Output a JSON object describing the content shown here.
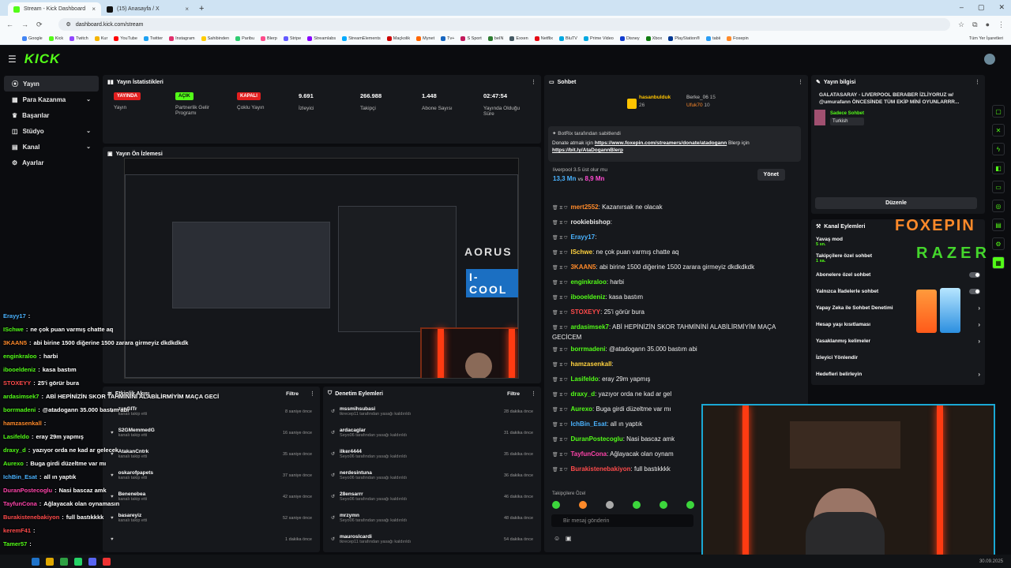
{
  "browser": {
    "tabs": [
      {
        "title": "Stream - Kick Dashboard"
      },
      {
        "title": "(15) Anasayfa / X"
      }
    ],
    "url": "dashboard.kick.com/stream",
    "bookmarks": [
      "Google",
      "Kick",
      "Twitch",
      "Kur",
      "YouTube",
      "Twitter",
      "Instagram",
      "Sahibinden",
      "Paribu",
      "Blerp",
      "Stripe",
      "Streamlabs",
      "StreamElements",
      "Maçkolik",
      "Mynet",
      "Tv+",
      "S Sport",
      "beIN",
      "Exxen",
      "Netflix",
      "BluTV",
      "Prime Video",
      "Disney",
      "Xbox",
      "PlayStation®",
      "tabii",
      "Foxepin"
    ],
    "all_bookmarks": "Tüm Yer İşaretleri"
  },
  "kick": {
    "logo": "KICK"
  },
  "sidebar": {
    "items": [
      {
        "label": "Yayın",
        "chev": ""
      },
      {
        "label": "Para Kazanma",
        "chev": "⌄"
      },
      {
        "label": "Başarılar",
        "chev": ""
      },
      {
        "label": "Stüdyo",
        "chev": "⌄"
      },
      {
        "label": "Kanal",
        "chev": "⌄"
      },
      {
        "label": "Ayarlar",
        "chev": ""
      }
    ]
  },
  "stats": {
    "title": "Yayın İstatistikleri",
    "cells": [
      {
        "pill": "YAYINDA",
        "label": "Yayın"
      },
      {
        "pill": "AÇIK",
        "label": "Partnerlik Gelir Programı"
      },
      {
        "pill": "KAPALI",
        "label": "Çoklu Yayın"
      },
      {
        "value": "9.691",
        "label": "İzleyici"
      },
      {
        "value": "266.988",
        "label": "Takipçi"
      },
      {
        "value": "1.448",
        "label": "Abone Sayısı"
      },
      {
        "value": "02:47:54",
        "label": "Yayında Olduğu Süre"
      }
    ]
  },
  "preview": {
    "title": "Yayın Ön İzlemesi"
  },
  "overlay_chat": [
    {
      "user": "Erayy17",
      "msg": ""
    },
    {
      "user": "ISchwe",
      "msg": "ne çok puan varmış chatte aq"
    },
    {
      "user": "3KAAN5",
      "msg": "abi birine 1500 diğerine 1500 zarara girmeyiz dkdkdkdk"
    },
    {
      "user": "enginkraloo",
      "msg": "harbi"
    },
    {
      "user": "ibooeldeniz",
      "msg": "kasa bastım"
    },
    {
      "user": "STOXEYY",
      "msg": "25'i görür bura"
    },
    {
      "user": "ardasimsek7",
      "msg": "ABİ HEPİNİZİN SKOR TAHMİNİNİ ALABİLİRMİYİM MAÇA GECİ"
    },
    {
      "user": "borrmadeni",
      "msg": "@atadogann 35.000 bastım abi"
    },
    {
      "user": "hamzasenkall",
      "msg": ""
    },
    {
      "user": "Lasifeldo",
      "msg": "eray 29m yapmış"
    },
    {
      "user": "draxy_d",
      "msg": "yazıyor orda ne kad ar gelecek"
    },
    {
      "user": "Aurexo",
      "msg": "Buga girdi düzeltme var mı"
    },
    {
      "user": "IchBin_Esat",
      "msg": "all ın yaptık"
    },
    {
      "user": "DuranPostecoglu",
      "msg": "Nasi bascaz amk"
    },
    {
      "user": "TayfunCona",
      "msg": "Ağlayacak olan oynamasın"
    },
    {
      "user": "Burakistenebakiyon",
      "msg": "full bastıkkkk"
    },
    {
      "user": "keremF41",
      "msg": ""
    },
    {
      "user": "Tamer57",
      "msg": ""
    }
  ],
  "activity": {
    "title": "Etkinlik Akışı",
    "filter": "Filtre",
    "items": [
      {
        "name": "zanGITr",
        "sub": "kanalı takip etti",
        "time": "8 saniye önce"
      },
      {
        "name": "S2GMemmedG",
        "sub": "kanalı takip etti",
        "time": "16 saniye önce"
      },
      {
        "name": "AtakanCntrk",
        "sub": "kanalı takip etti",
        "time": "35 saniye önce"
      },
      {
        "name": "oskarofpapets",
        "sub": "kanalı takip etti",
        "time": "37 saniye önce"
      },
      {
        "name": "Benenebea",
        "sub": "kanalı takip etti",
        "time": "42 saniye önce"
      },
      {
        "name": "basareyiz",
        "sub": "kanalı takip etti",
        "time": "52 saniye önce"
      },
      {
        "name": "",
        "sub": "",
        "time": "1 dakika önce"
      }
    ]
  },
  "moderation": {
    "title": "Denetim Eylemleri",
    "filter": "Filtre",
    "items": [
      {
        "name": "mssmihsubasi",
        "sub": "tkrecep11 tarafından yasağı kaldırıldı",
        "time": "28 dakika önce"
      },
      {
        "name": "ardacaglar",
        "sub": "Seyo06 tarafından yasağı kaldırıldı",
        "time": "31 dakika önce"
      },
      {
        "name": "ilker4444",
        "sub": "Seyo06 tarafından yasağı kaldırıldı",
        "time": "35 dakika önce"
      },
      {
        "name": "nerdesintuna",
        "sub": "Seyo06 tarafından yasağı kaldırıldı",
        "time": "36 dakika önce"
      },
      {
        "name": "28ensarrr",
        "sub": "Seyo06 tarafından yasağı kaldırıldı",
        "time": "46 dakika önce"
      },
      {
        "name": "mrzymn",
        "sub": "Seyo06 tarafından yasağı kaldırıldı",
        "time": "48 dakika önce"
      },
      {
        "name": "mauroslcardi",
        "sub": "tkrecep11 tarafından yasağı kaldırıldı",
        "time": "54 dakika önce"
      }
    ]
  },
  "chat": {
    "title": "Sohbet",
    "top_gifters": [
      {
        "name": "hasanbulduk",
        "count": "26"
      },
      {
        "name": "Berke_06",
        "count": "15"
      },
      {
        "name": "Ufuk70",
        "count": "10"
      }
    ],
    "pinned": {
      "by": "BotRix tarafından sabitlendi",
      "text": "Donate atmak için",
      "link1": "https://www.foxepin.com/streamers/donate/atadogann",
      "mid": "Blerp için",
      "link2": "https://bit.ly/AtaDogannBlerp"
    },
    "poll": {
      "question": "liverpool 3.5 üst olur mu",
      "a": "13,3 Mn",
      "vs": "vs",
      "b": "8,9 Mn",
      "manage": "Yönet"
    },
    "messages": [
      {
        "user": "mert2552",
        "color": "#ff8a2a",
        "msg": "Kazanırsak ne olacak"
      },
      {
        "user": "rookiebishop",
        "color": "#e8e8e8",
        "msg": ""
      },
      {
        "user": "Erayy17",
        "color": "#4ab3ff",
        "msg": ""
      },
      {
        "user": "ISchwe",
        "color": "#ffd23f",
        "msg": "ne çok puan varmış chatte aq"
      },
      {
        "user": "3KAAN5",
        "color": "#ff8a2a",
        "msg": "abi birine 1500 diğerine 1500 zarara girmeyiz dkdkdkdk"
      },
      {
        "user": "enginkraloo",
        "color": "#53fc18",
        "msg": "harbi"
      },
      {
        "user": "ibooeldeniz",
        "color": "#53fc18",
        "msg": "kasa bastım"
      },
      {
        "user": "STOXEYY",
        "color": "#ff4b4b",
        "msg": "25'i görür bura"
      },
      {
        "user": "ardasimsek7",
        "color": "#53fc18",
        "msg": "ABİ HEPİNİZİN SKOR TAHMİNİNİ ALABİLİRMİYİM MAÇA GECİCEM"
      },
      {
        "user": "borrmadeni",
        "color": "#53fc18",
        "msg": "@atadogann 35.000 bastım abi"
      },
      {
        "user": "hamzasenkall",
        "color": "#ffd23f",
        "msg": ""
      },
      {
        "user": "Lasifeldo",
        "color": "#53fc18",
        "msg": "eray 29m yapmış"
      },
      {
        "user": "draxy_d",
        "color": "#53fc18",
        "msg": "yazıyor orda ne kad ar gel"
      },
      {
        "user": "Aurexo",
        "color": "#53fc18",
        "msg": "Buga girdi düzeltme var mı"
      },
      {
        "user": "IchBin_Esat",
        "color": "#4ab3ff",
        "msg": "all ın yaptık"
      },
      {
        "user": "DuranPostecoglu",
        "color": "#53fc18",
        "msg": "Nasi bascaz amk"
      },
      {
        "user": "TayfunCona",
        "color": "#f4a",
        "msg": "Ağlayacak olan oynam"
      },
      {
        "user": "Burakistenebakiyon",
        "color": "#ff4b4b",
        "msg": "full bastıkkkk"
      }
    ],
    "followers_only_label": "Takipçilere Özel",
    "input_placeholder": "Bir mesaj gönderin"
  },
  "stream_info": {
    "title": "Yayın bilgisi",
    "stream_title": "GALATASARAY - LIVERPOOL BERABER İZLİYORUZ w/ @umurafann ÖNCESİNDE TÜM EKİP MİNİ OYUNLARRR...",
    "tag1": "Sadece Sohbet",
    "tag2": "Turkish",
    "edit": "Düzenle"
  },
  "channel_actions": {
    "title": "Kanal Eylemleri",
    "rows": [
      {
        "label": "Yavaş mod",
        "sub": "5 sn.",
        "right": ""
      },
      {
        "label": "Takipçilere özel sohbet",
        "sub": "1 sa.",
        "right": ""
      },
      {
        "label": "Abonelere özel sohbet",
        "sub": "",
        "right": "toggle"
      },
      {
        "label": "Yalnızca İfadelerle sohbet",
        "sub": "",
        "right": "toggle"
      },
      {
        "label": "Yapay Zeka ile Sohbet Denetimi",
        "sub": "",
        "right": "›"
      },
      {
        "label": "Hesap yaşı kısıtlaması",
        "sub": "",
        "right": "›"
      },
      {
        "label": "Yasaklanmış kelimeler",
        "sub": "",
        "right": "›"
      },
      {
        "label": "İzleyici Yönlendir",
        "sub": "",
        "right": ""
      },
      {
        "label": "Hedefleri belirleyin",
        "sub": "",
        "right": "›"
      }
    ]
  },
  "sponsors": {
    "foxepin": "FOXEPIN",
    "razer": "RAZER",
    "icool": "I-COOL",
    "aorus": "AORUS"
  },
  "taskbar": {
    "date": "30.09.2025"
  },
  "colors": {
    "kick_green": "#53fc18",
    "live_red": "#e21f1f",
    "panel": "#16181c",
    "bg": "#0b0c0f"
  }
}
